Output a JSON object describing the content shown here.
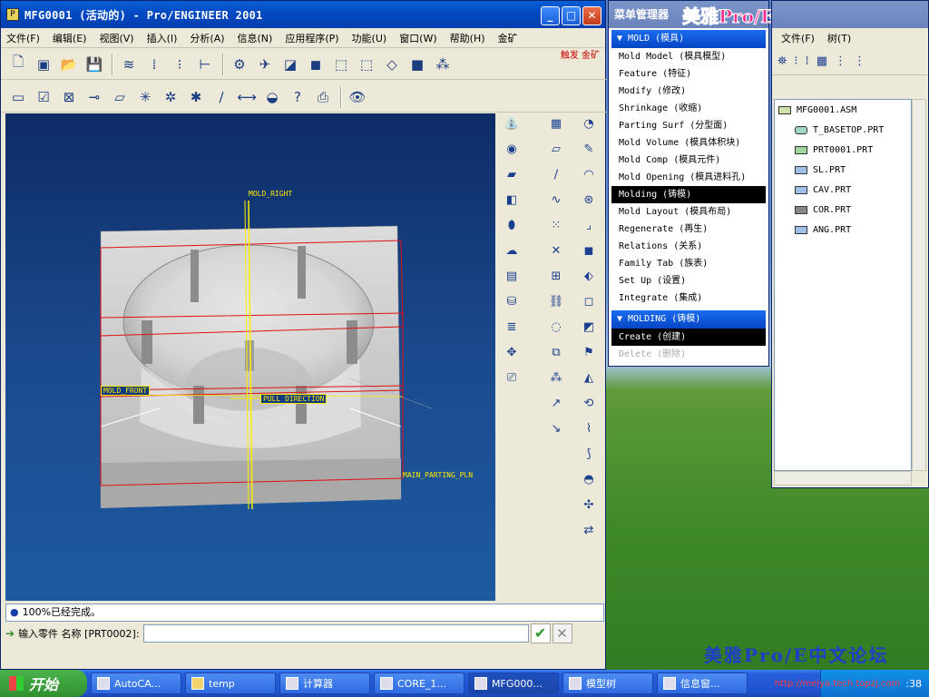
{
  "main_window": {
    "title": "MFG0001 (活动的) - Pro/ENGINEER 2001",
    "menu": [
      "文件(F)",
      "编辑(E)",
      "视图(V)",
      "插入(I)",
      "分析(A)",
      "信息(N)",
      "应用程序(P)",
      "功能(U)",
      "窗口(W)",
      "帮助(H)",
      "金矿"
    ],
    "toolbar_badge": "触发 金矿",
    "viewport_labels": {
      "mold_right": "MOLD_RIGHT",
      "mold_front": "MOLD_FRONT",
      "pull_direction": "PULL DIRECTION",
      "main_parting_pln": "MAIN_PARTING_PLN"
    },
    "message": "100%已经完成。",
    "prompt_label": "输入零件 名称 [PRT0002]:",
    "prompt_value": ""
  },
  "menu_manager": {
    "title": "菜单管理器",
    "mold_header": "MOLD (模具)",
    "mold_items": [
      "Mold Model (模具模型)",
      "Feature (特征)",
      "Modify (修改)",
      "Shrinkage (收缩)",
      "Parting Surf (分型面)",
      "Mold Volume (模具体积块)",
      "Mold Comp (模具元件)",
      "Mold Opening (模具进料孔)",
      "Molding (铸模)",
      "Mold Layout (模具布局)",
      "Regenerate (再生)",
      "Relations (关系)",
      "Family Tab (族表)",
      "Set Up (设置)",
      "Integrate (集成)"
    ],
    "molding_header": "MOLDING (铸模)",
    "molding_items": [
      "Create (创建)",
      "Delete (删除)"
    ]
  },
  "model_tree": {
    "menu": [
      "文件(F)",
      "树(T)"
    ],
    "root": "MFG0001.ASM",
    "children": [
      "T_BASETOP.PRT",
      "PRT0001.PRT",
      "SL.PRT",
      "CAV.PRT",
      "COR.PRT",
      "ANG.PRT"
    ]
  },
  "forum": {
    "banner": "美雅Pro/E中文论坛",
    "footer": "美雅Pro/E中文论坛",
    "url": "http://meiya.tech.topzj.com"
  },
  "taskbar": {
    "start": "开始",
    "tasks": [
      "AutoCA...",
      "temp",
      "计算器",
      "CORE_1...",
      "MFG000...",
      "模型树",
      "信息窗..."
    ],
    "clock": ":38"
  }
}
